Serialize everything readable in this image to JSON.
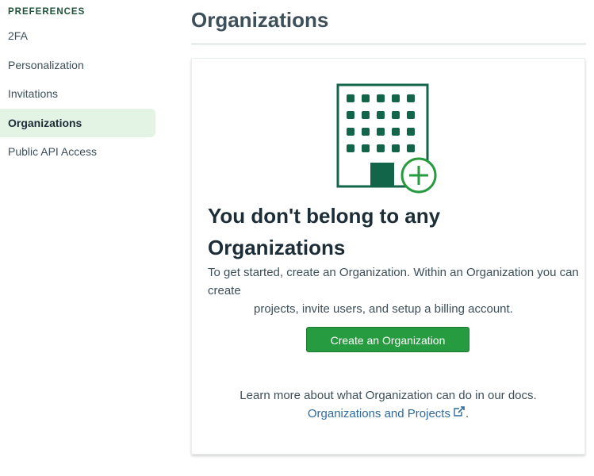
{
  "sidebar": {
    "section": "PREFERENCES",
    "items": [
      {
        "label": "2FA"
      },
      {
        "label": "Personalization"
      },
      {
        "label": "Invitations"
      },
      {
        "label": "Organizations",
        "active": true
      },
      {
        "label": "Public API Access"
      }
    ]
  },
  "main": {
    "title": "Organizations",
    "empty": {
      "heading_line1": "You don't belong to any",
      "heading_line2": "Organizations",
      "text_line1": "To get started, create an Organization. Within an Organization you can create",
      "text_line2": "projects, invite users, and setup a billing account.",
      "button": "Create an Organization",
      "learn_more": "Learn more about what Organization can do in our docs.",
      "link": "Organizations and Projects",
      "link_suffix": "."
    }
  },
  "colors": {
    "accent": "#279b3f",
    "icon": "#13654a",
    "link": "#2e6a9e"
  }
}
